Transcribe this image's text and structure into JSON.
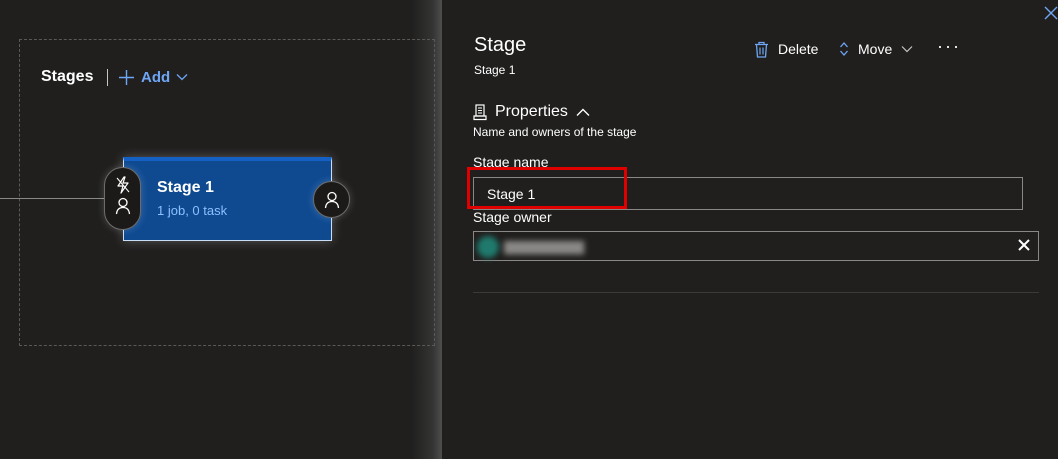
{
  "canvas": {
    "stages_title": "Stages",
    "add_label": "Add",
    "stage_card": {
      "name": "Stage 1",
      "summary": "1 job, 0 task"
    },
    "icons": {
      "trigger": "lightning-bolt-icon",
      "pre_approver": "person-icon",
      "post_approver": "person-icon"
    }
  },
  "panel": {
    "title": "Stage",
    "subtitle": "Stage 1",
    "commands": {
      "delete_label": "Delete",
      "move_label": "Move",
      "more_label": "···"
    },
    "properties": {
      "header": "Properties",
      "description": "Name and owners of the stage"
    },
    "fields": {
      "stage_name_label": "Stage name",
      "stage_name_value": "Stage 1",
      "stage_owner_label": "Stage owner",
      "stage_owner_clear": "×"
    }
  },
  "colors": {
    "background": "#201f1e",
    "accent_blue": "#6ea6f5",
    "stage_card_fill": "#0f4a91",
    "highlight_red": "#e00000"
  }
}
